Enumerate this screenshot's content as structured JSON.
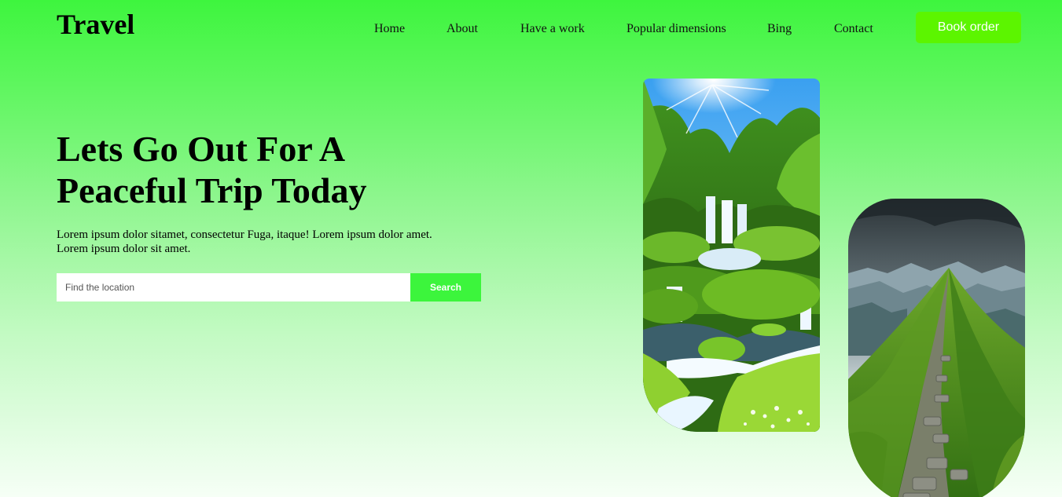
{
  "brand": {
    "logo": "Travel"
  },
  "nav": {
    "items": [
      {
        "label": "Home"
      },
      {
        "label": "About"
      },
      {
        "label": "Have a work"
      },
      {
        "label": "Popular dimensions"
      },
      {
        "label": "Bing"
      },
      {
        "label": "Contact"
      }
    ],
    "book_label": "Book order"
  },
  "hero": {
    "title_line1": "Lets Go Out For A",
    "title_line2": "Peaceful Trip Today",
    "description": "Lorem ipsum dolor sitamet, consectetur Fuga, itaque! Lorem ipsum dolor amet. Lorem ipsum dolor sit amet.",
    "search": {
      "placeholder": "Find the location",
      "value": "",
      "button_label": "Search"
    }
  },
  "gallery": [
    {
      "subject": "waterfall"
    },
    {
      "subject": "mountain-trail"
    }
  ],
  "colors": {
    "accent": "#3cf53c",
    "book_button": "#5cf500",
    "gradient_top": "#3ef53e",
    "gradient_bottom": "#f6fff6"
  }
}
